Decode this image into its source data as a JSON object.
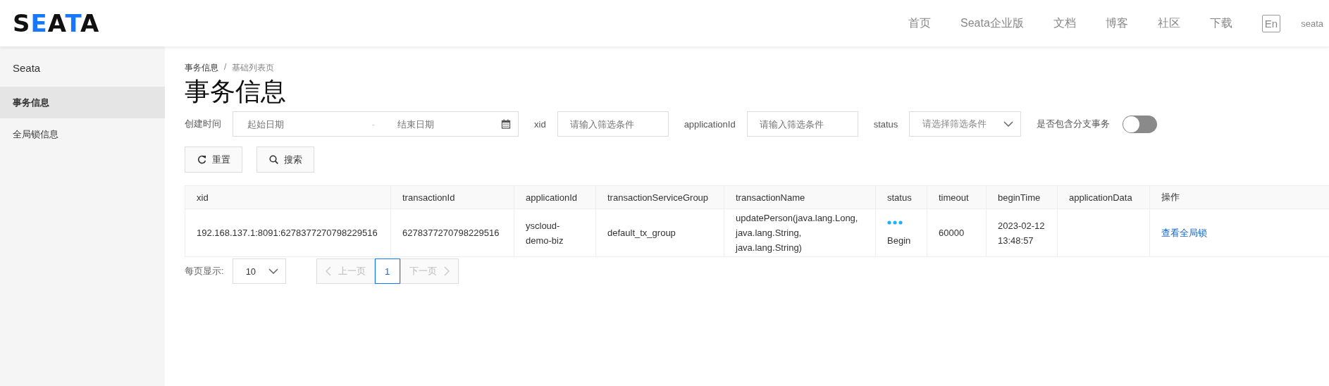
{
  "header": {
    "logo": "SEATA",
    "nav": [
      {
        "label": "首页"
      },
      {
        "label": "Seata企业版"
      },
      {
        "label": "文档"
      },
      {
        "label": "博客"
      },
      {
        "label": "社区"
      },
      {
        "label": "下载"
      }
    ],
    "language": "En",
    "user": "seata"
  },
  "sidebar": {
    "title": "Seata",
    "items": [
      {
        "label": "事务信息",
        "selected": true
      },
      {
        "label": "全局锁信息",
        "selected": false
      }
    ]
  },
  "breadcrumb": [
    "事务信息",
    "基础列表页"
  ],
  "breadcrumb_separator": "/",
  "page_title": "事务信息",
  "filters": {
    "created_label": "创建时间",
    "start_placeholder": "起始日期",
    "separator": "-",
    "end_placeholder": "结束日期",
    "xid_label": "xid",
    "xid_placeholder": "请输入筛选条件",
    "app_label": "applicationId",
    "app_placeholder": "请输入筛选条件",
    "status_label": "status",
    "status_placeholder": "请选择筛选条件",
    "branch_label": "是否包含分支事务",
    "branch_on": false
  },
  "buttons": [
    {
      "kind": "reset",
      "label": "重置"
    },
    {
      "kind": "search",
      "label": "搜索"
    }
  ],
  "table": {
    "columns": [
      "xid",
      "transactionId",
      "applicationId",
      "transactionServiceGroup",
      "transactionName",
      "status",
      "timeout",
      "beginTime",
      "applicationData",
      "操作"
    ],
    "rows": [
      {
        "xid": "192.168.137.1:8091:6278377270798229516",
        "transactionId": "6278377270798229516",
        "applicationId": "yscloud-demo-biz",
        "transactionServiceGroup": "default_tx_group",
        "transactionName": "updatePerson(java.lang.Long, java.lang.String, java.lang.String)",
        "status": "Begin",
        "timeout": "60000",
        "beginTime": "2023-02-12 13:48:57",
        "action": "查看全局锁"
      }
    ]
  },
  "pagination": {
    "page_size_label": "每页显示:",
    "page_size": "10",
    "prev": "上一页",
    "pages": [
      {
        "label": "1",
        "selected": true
      }
    ],
    "next": "下一页"
  }
}
